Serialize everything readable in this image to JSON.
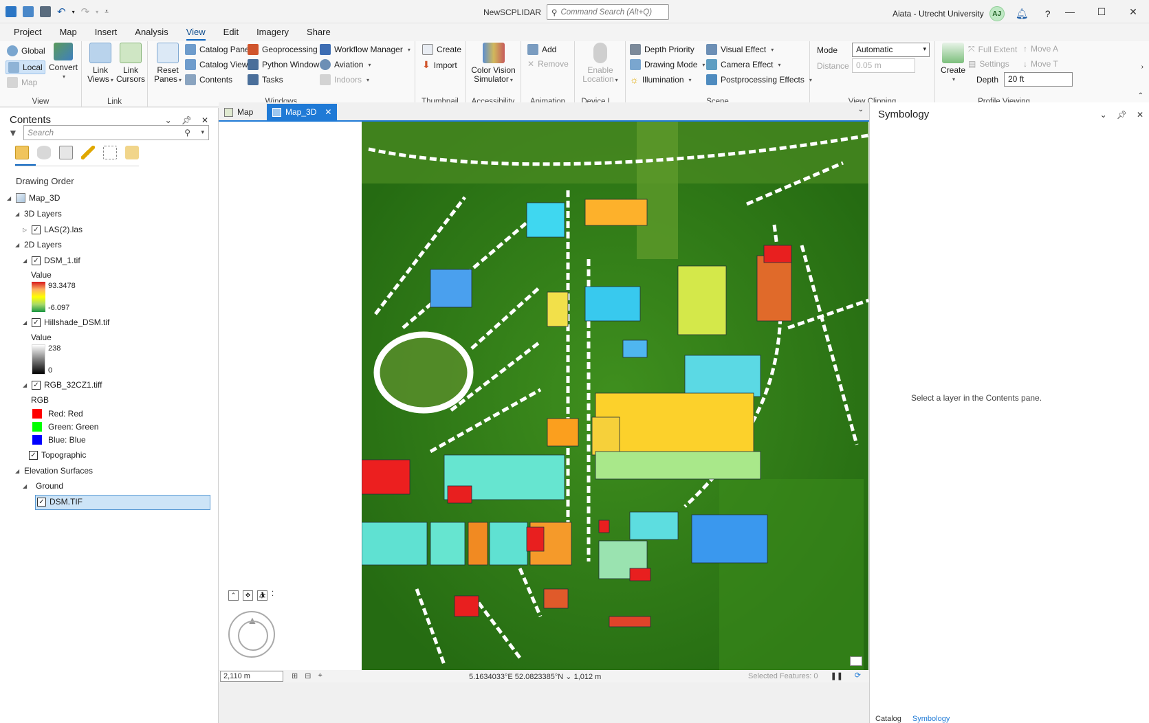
{
  "app": {
    "title": "NewSCPLIDAR",
    "command_search_placeholder": "Command Search (Alt+Q)",
    "user_name": "Aiata - Utrecht University",
    "user_initials": "AJ"
  },
  "ribbon_tabs": [
    "Project",
    "Map",
    "Insert",
    "Analysis",
    "View",
    "Edit",
    "Imagery",
    "Share"
  ],
  "ribbon": {
    "view_group": {
      "global": "Global",
      "local": "Local",
      "convert": "Convert",
      "map": "Map",
      "label": "View"
    },
    "link_group": {
      "link_views": "Link Views",
      "link_cursors": "Link Cursors",
      "label": "Link"
    },
    "windows_group": {
      "reset_panes": "Reset Panes",
      "catalog_pane": "Catalog Pane",
      "catalog_view": "Catalog View",
      "contents": "Contents",
      "geoprocessing": "Geoprocessing",
      "python_window": "Python Window",
      "tasks": "Tasks",
      "workflow_manager": "Workflow Manager",
      "aviation": "Aviation",
      "indoors": "Indoors",
      "label": "Windows"
    },
    "thumbnail_group": {
      "create": "Create",
      "import": "Import",
      "label": "Thumbnail"
    },
    "accessibility_group": {
      "cvs": "Color Vision Simulator",
      "label": "Accessibility"
    },
    "animation_group": {
      "add": "Add",
      "remove": "Remove",
      "label": "Animation"
    },
    "device_group": {
      "enable_location": "Enable Location",
      "label": "Device L..."
    },
    "scene_group": {
      "depth_priority": "Depth Priority",
      "drawing_mode": "Drawing Mode",
      "illumination": "Illumination",
      "visual_effect": "Visual Effect",
      "camera_effect": "Camera Effect",
      "postprocessing": "Postprocessing Effects",
      "label": "Scene"
    },
    "view_clipping_group": {
      "mode_label": "Mode",
      "mode_value": "Automatic",
      "distance_label": "Distance",
      "distance_value": "0.05  m",
      "label": "View Clipping"
    },
    "profile_group": {
      "create": "Create",
      "full_extent": "Full Extent",
      "settings": "Settings",
      "move_a": "Move A",
      "move_t": "Move T",
      "depth_label": "Depth",
      "depth_value": "20 ft",
      "label": "Profile Viewing"
    }
  },
  "contents": {
    "title": "Contents",
    "search_placeholder": "Search",
    "section": "Drawing Order",
    "map_name": "Map_3D",
    "layers_3d": "3D Layers",
    "las": "LAS(2).las",
    "layers_2d": "2D Layers",
    "dsm": "DSM_1.tif",
    "value_label": "Value",
    "dsm_max": "93.3478",
    "dsm_min": "-6.097",
    "hillshade": "Hillshade_DSM.tif",
    "hs_max": "238",
    "hs_min": "0",
    "rgb": "RGB_32CZ1.tiff",
    "rgb_label": "RGB",
    "red": "Red:   Red",
    "green": "Green: Green",
    "blue": "Blue:  Blue",
    "topographic": "Topographic",
    "elevation_surfaces": "Elevation Surfaces",
    "ground": "Ground",
    "dsm_tif": "DSM.TIF"
  },
  "map_tabs": [
    "Map",
    "Map_3D"
  ],
  "status": {
    "scale": "2,110 m",
    "coords": "5.1634033°E 52.0823385°N  ⌄  1,012 m",
    "selected": "Selected Features: 0"
  },
  "symbology": {
    "title": "Symbology",
    "hint": "Select a layer in the Contents pane.",
    "bottom_tabs": [
      "Catalog",
      "Symbology"
    ]
  },
  "colors": {
    "accent": "#1f7ad6",
    "ramp_high": "#d7191c",
    "ramp_mid": "#ffff00",
    "ramp_low": "#1a9641"
  }
}
